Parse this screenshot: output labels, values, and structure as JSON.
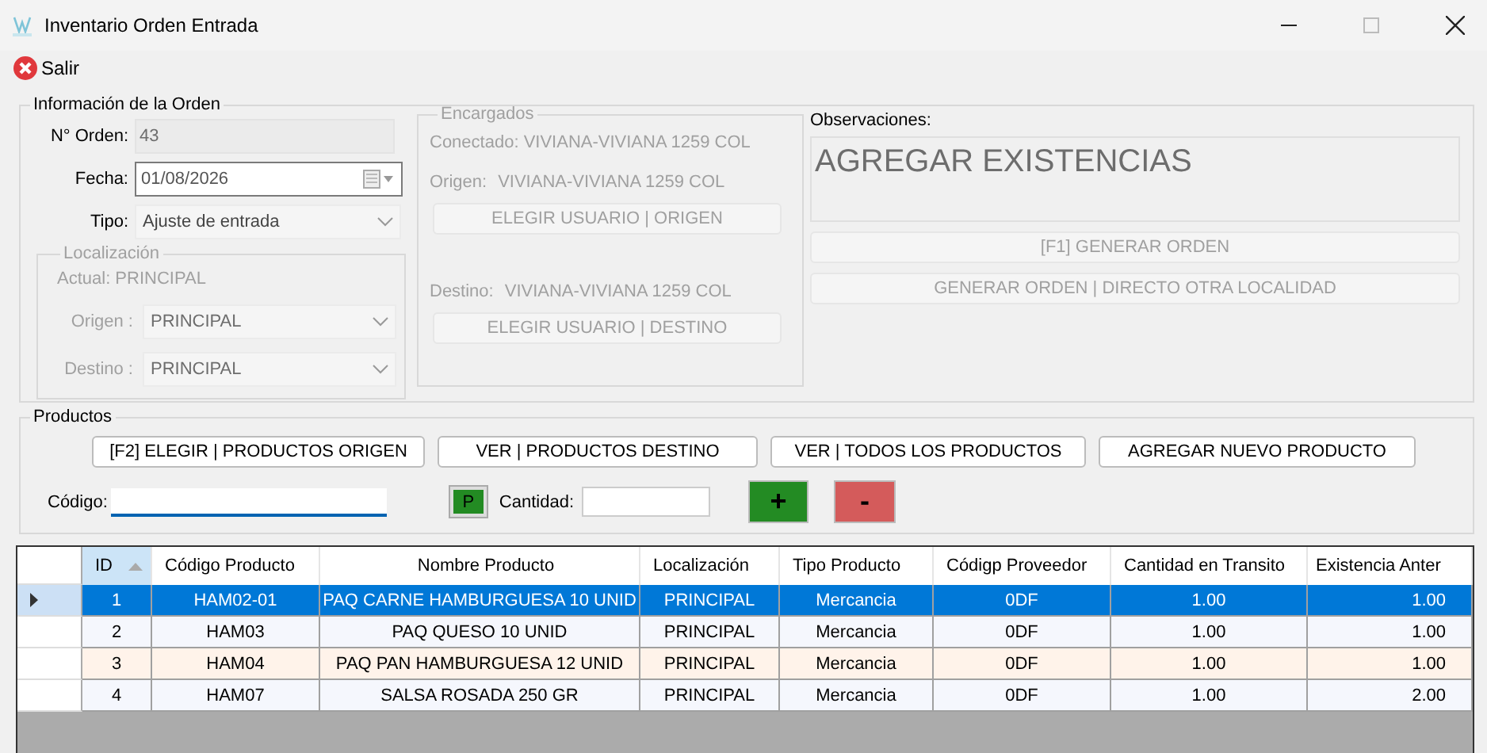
{
  "window": {
    "title": "Inventario Orden Entrada"
  },
  "toolbar": [
    {
      "label": "Salir"
    }
  ],
  "order_info": {
    "legend": "Información de la Orden",
    "order_number": {
      "label": "N° Orden:",
      "value": "43"
    },
    "date": {
      "label": "Fecha:",
      "value": "01/08/2026"
    },
    "type": {
      "label": "Tipo:",
      "value": "Ajuste de entrada"
    },
    "location": {
      "legend": "Localización",
      "disabled": true,
      "current": "Actual: PRINCIPAL",
      "origin": {
        "label": "Origen :",
        "value": "PRINCIPAL"
      },
      "destination": {
        "label": "Destino :",
        "value": "PRINCIPAL"
      }
    }
  },
  "managers": {
    "legend": "Encargados",
    "disabled": true,
    "connected": "Conectado: VIVIANA-VIVIANA 1259 COL",
    "origin": {
      "label": "Origen:",
      "value": "VIVIANA-VIVIANA 1259 COL"
    },
    "origin_button": {
      "label": "ELEGIR USUARIO | ORIGEN",
      "disabled": true
    },
    "destination": {
      "label": "Destino:",
      "value": "VIVIANA-VIVIANA 1259 COL"
    },
    "destination_button": {
      "label": "ELEGIR USUARIO | DESTINO",
      "disabled": true
    }
  },
  "observations": {
    "label": "Observaciones:",
    "value": "AGREGAR EXISTENCIAS",
    "buttons": [
      {
        "label": "[F1]   GENERAR ORDEN",
        "disabled": true
      },
      {
        "label": "GENERAR ORDEN | DIRECTO OTRA LOCALIDAD",
        "disabled": true
      }
    ]
  },
  "products": {
    "legend": "Productos",
    "buttons": [
      {
        "label": "[F2]  ELEGIR | PRODUCTOS ORIGEN"
      },
      {
        "label": "VER | PRODUCTOS DESTINO"
      },
      {
        "label": "VER | TODOS LOS PRODUCTOS"
      },
      {
        "label": "AGREGAR NUEVO PRODUCTO"
      }
    ],
    "code": {
      "label": "Código:"
    },
    "p_button": "P",
    "quantity": {
      "label": "Cantidad:"
    },
    "add_button": "+",
    "remove_button": "-"
  },
  "table": {
    "columns": [
      {
        "label": "ID",
        "sorted": true
      },
      {
        "label": "Código Producto",
        "sorted": false
      },
      {
        "label": "Nombre Producto",
        "sorted": false
      },
      {
        "label": "Localización",
        "sorted": false
      },
      {
        "label": "Tipo Producto",
        "sorted": false
      },
      {
        "label": "Códigp Proveedor",
        "sorted": false
      },
      {
        "label": "Cantidad en Transito",
        "sorted": false
      },
      {
        "label": "Existencia Anter",
        "sorted": false
      }
    ],
    "rows": [
      {
        "selected": true,
        "cells": [
          "1",
          "HAM02-01",
          "PAQ CARNE HAMBURGUESA 10 UNID",
          "PRINCIPAL",
          "Mercancia",
          "0DF",
          "1.00",
          "1.00"
        ]
      },
      {
        "selected": false,
        "color": "#f5f7fd",
        "cells": [
          "2",
          "HAM03",
          "PAQ QUESO 10 UNID",
          "PRINCIPAL",
          "Mercancia",
          "0DF",
          "1.00",
          "1.00"
        ]
      },
      {
        "selected": false,
        "color": "#fff3ea",
        "cells": [
          "3",
          "HAM04",
          "PAQ PAN HAMBURGUESA 12 UNID",
          "PRINCIPAL",
          "Mercancia",
          "0DF",
          "1.00",
          "1.00"
        ]
      },
      {
        "selected": false,
        "color": "#f5f7fd",
        "cells": [
          "4",
          "HAM07",
          "SALSA ROSADA 250 GR",
          "PRINCIPAL",
          "Mercancia",
          "0DF",
          "1.00",
          "2.00"
        ]
      }
    ]
  }
}
